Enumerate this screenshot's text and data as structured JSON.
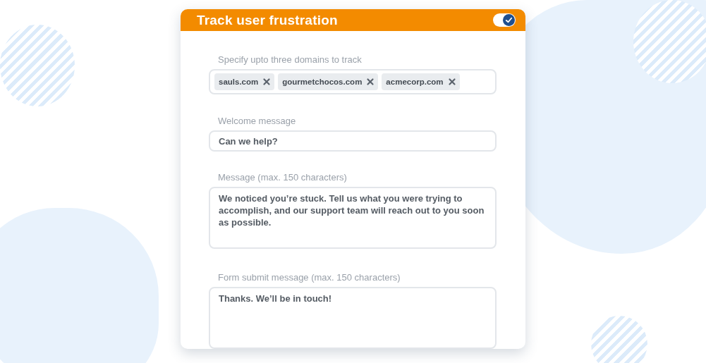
{
  "panel": {
    "title": "Track user frustration",
    "enabled": true
  },
  "domains": {
    "label": "Specify upto three domains to track",
    "tags": [
      {
        "text": "sauls.com"
      },
      {
        "text": "gourmetchocos.com"
      },
      {
        "text": "acmecorp.com"
      }
    ]
  },
  "fields": [
    {
      "kind": "input",
      "label": "Welcome message",
      "value": "Can we help?"
    },
    {
      "kind": "textarea",
      "label": "Message (max. 150 characters)",
      "value": "We noticed you’re stuck. Tell us what you were trying to accomplish, and our support team will reach out to you soon as possible."
    },
    {
      "kind": "textarea",
      "label": "Form submit message (max. 150 characters)",
      "value": "Thanks. We’ll be in touch!"
    }
  ]
}
